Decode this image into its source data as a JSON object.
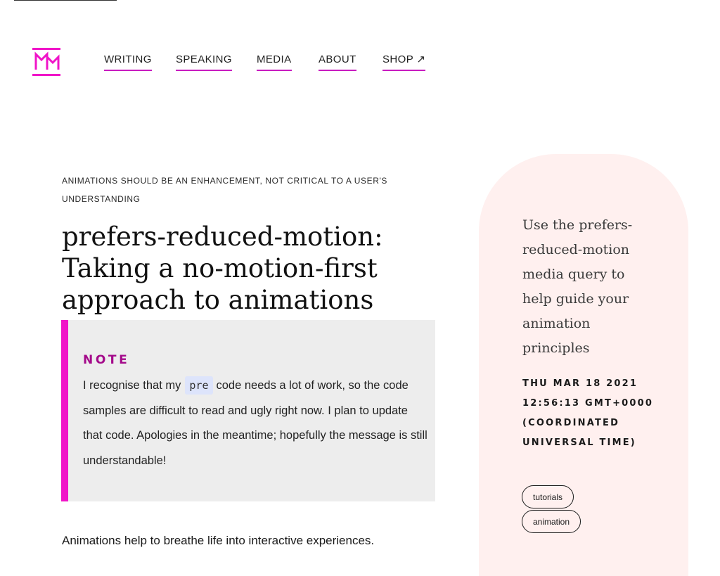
{
  "nav": {
    "items": [
      {
        "label": "WRITING"
      },
      {
        "label": "SPEAKING"
      },
      {
        "label": "MEDIA"
      },
      {
        "label": "ABOUT"
      },
      {
        "label": "SHOP ↗"
      }
    ]
  },
  "brand": {
    "accent": "#f014c8",
    "logo_icon": "monogram-logo-icon"
  },
  "article": {
    "kicker": "ANIMATIONS SHOULD BE AN ENHANCEMENT, NOT CRITICAL TO A USER'S UNDERSTANDING",
    "title": "prefers-reduced-motion: Taking a no-motion-first approach to animations",
    "note": {
      "label": "NOTE",
      "text_before": "I recognise that my",
      "code": "pre",
      "text_after": "code needs a lot of work, so the code samples are difficult to read and ugly right now. I plan to update that code. Apologies in the meantime; hopefully the message is still understandable!"
    },
    "intro": "Animations help to breathe life into interactive experiences."
  },
  "sidebar": {
    "summary": "Use the prefers-reduced-motion media query to help guide your animation principles",
    "date": "THU MAR 18 2021 12:56:13 GMT+0000 (COORDINATED UNIVERSAL TIME)",
    "tags": [
      "tutorials",
      "animation"
    ]
  }
}
